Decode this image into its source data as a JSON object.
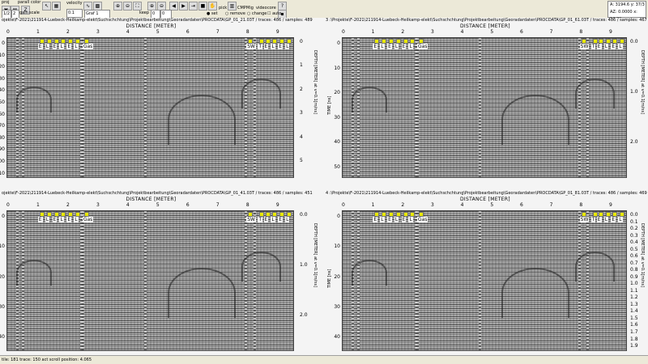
{
  "toolbar": {
    "proj_label": "proj",
    "parall_label": "parall",
    "color_label": "color",
    "z_label": "Z",
    "val_a": "1/2",
    "val_b": "2",
    "gain_label": "gain",
    "scale_label": "scale",
    "velocity_label": "velocity",
    "velocity_value": "0.1",
    "filter_value": "Graf 1",
    "keep_label": "keep",
    "keep_value": "0",
    "zero_value": "0",
    "pick_label": "pick",
    "cmp_label": "CMP",
    "migration_label": "Mig",
    "video_label": "video",
    "core_label": "core",
    "opt_set": "set",
    "opt_remove": "remove",
    "opt_change": "change",
    "opt_auto": "auto"
  },
  "coords": {
    "a": "A: 3194.6",
    "az": "AZ: 0.0000",
    "y": "y: 37/3",
    "x": "x: 14.00"
  },
  "panels": [
    {
      "title": "ojekte\\F-2021\\211914-Luebeck-Heilkamp-elekt\\Suchschchtung\\Projektbearbeitung\\Georadardaten\\PROCDATA\\GP_01_21.03T / traces: 486 / samples: 489",
      "xlabel": "DISTANCE [METER]",
      "xticks": [
        "0",
        "1",
        "2",
        "3",
        "4",
        "5",
        "6",
        "7",
        "8",
        "9"
      ],
      "yticks_left": [
        "0",
        "10",
        "20",
        "30",
        "40",
        "50",
        "60",
        "70",
        "80",
        "90",
        "100",
        "110"
      ],
      "yticks_right": [
        "0",
        "1",
        "2",
        "3",
        "4",
        "5"
      ],
      "yaxis": "DEPTH [METER] at v=0.1[m/ns]",
      "markers": [
        "E",
        "L",
        "E",
        "L",
        "E",
        "L",
        "Gas",
        "SW",
        "T",
        "E",
        "L",
        "E",
        "L"
      ]
    },
    {
      "title": "3 :\\Projekte\\F-2021\\211914-Luebeck-Heilkamp-elekt\\Suchschchtung\\Projektbearbeitung\\Georadardaten\\PROCDATA\\GP_01_61.03T / traces: 486 / samples: 467",
      "xlabel": "DISTANCE [METER]",
      "xticks": [
        "0",
        "1",
        "2",
        "3",
        "4",
        "5",
        "6",
        "7",
        "8",
        "9"
      ],
      "yticks_left": [
        "0",
        "10",
        "20",
        "30",
        "40",
        "50"
      ],
      "yticks_right": [
        "0.0",
        "1.0",
        "2.0"
      ],
      "ylabel": "TIME [ns]",
      "yaxis": "DEPTH [METER] at v=0.1[m/ns]",
      "markers": [
        "E",
        "L",
        "E",
        "L",
        "E",
        "L",
        "Gas",
        "SW",
        "T",
        "E",
        "L",
        "E",
        "L"
      ]
    },
    {
      "title": "ojekte\\F-2021\\211914-Luebeck-Heilkamp-elekt\\Suchschchtung\\Projektbearbeitung\\Georadardaten\\PROCDATA\\GP_01_41.03T / traces: 486 / samples: 451",
      "xlabel": "DISTANCE [METER]",
      "xticks": [
        "0",
        "1",
        "2",
        "3",
        "4",
        "5",
        "6",
        "7",
        "8",
        "9"
      ],
      "yticks_left": [
        "0",
        "10",
        "20",
        "30",
        "40"
      ],
      "yticks_right": [
        "0.0",
        "1.0",
        "2.0"
      ],
      "yaxis": "DEPTH [METER] at v=0.1[m/ns]",
      "markers": [
        "E",
        "L",
        "E",
        "L",
        "E",
        "L",
        "Gas",
        "SW",
        "T",
        "E",
        "L",
        "E",
        "L"
      ]
    },
    {
      "title": "4 :\\Projekte\\F-2021\\211914-Luebeck-Heilkamp-elekt\\Suchschchtung\\Projektbearbeitung\\Georadardaten\\PROCDATA\\GP_01_81.03T / traces: 486 / samples: 469",
      "xlabel": "DISTANCE [METER]",
      "xticks": [
        "0",
        "1",
        "2",
        "3",
        "4",
        "5",
        "6",
        "7",
        "8",
        "9"
      ],
      "yticks_left": [
        "0",
        "10",
        "20",
        "30",
        "40"
      ],
      "yticks_right": [
        "0.0",
        "0.1",
        "0.2",
        "0.3",
        "0.4",
        "0.5",
        "0.6",
        "0.7",
        "0.8",
        "0.9",
        "1.0",
        "1.1",
        "1.2",
        "1.3",
        "1.4",
        "1.5",
        "1.6",
        "1.7",
        "1.8",
        "1.9"
      ],
      "ylabel": "TIME [ns]",
      "yaxis": "DEPTH [METER] at v=0.1[m/ns]",
      "markers": [
        "E",
        "L",
        "E",
        "L",
        "E",
        "L",
        "Gas",
        "SW",
        "T",
        "E",
        "L",
        "E",
        "L"
      ]
    }
  ],
  "status": "tile: 181  trace: 150   act scroll position: 4.065"
}
